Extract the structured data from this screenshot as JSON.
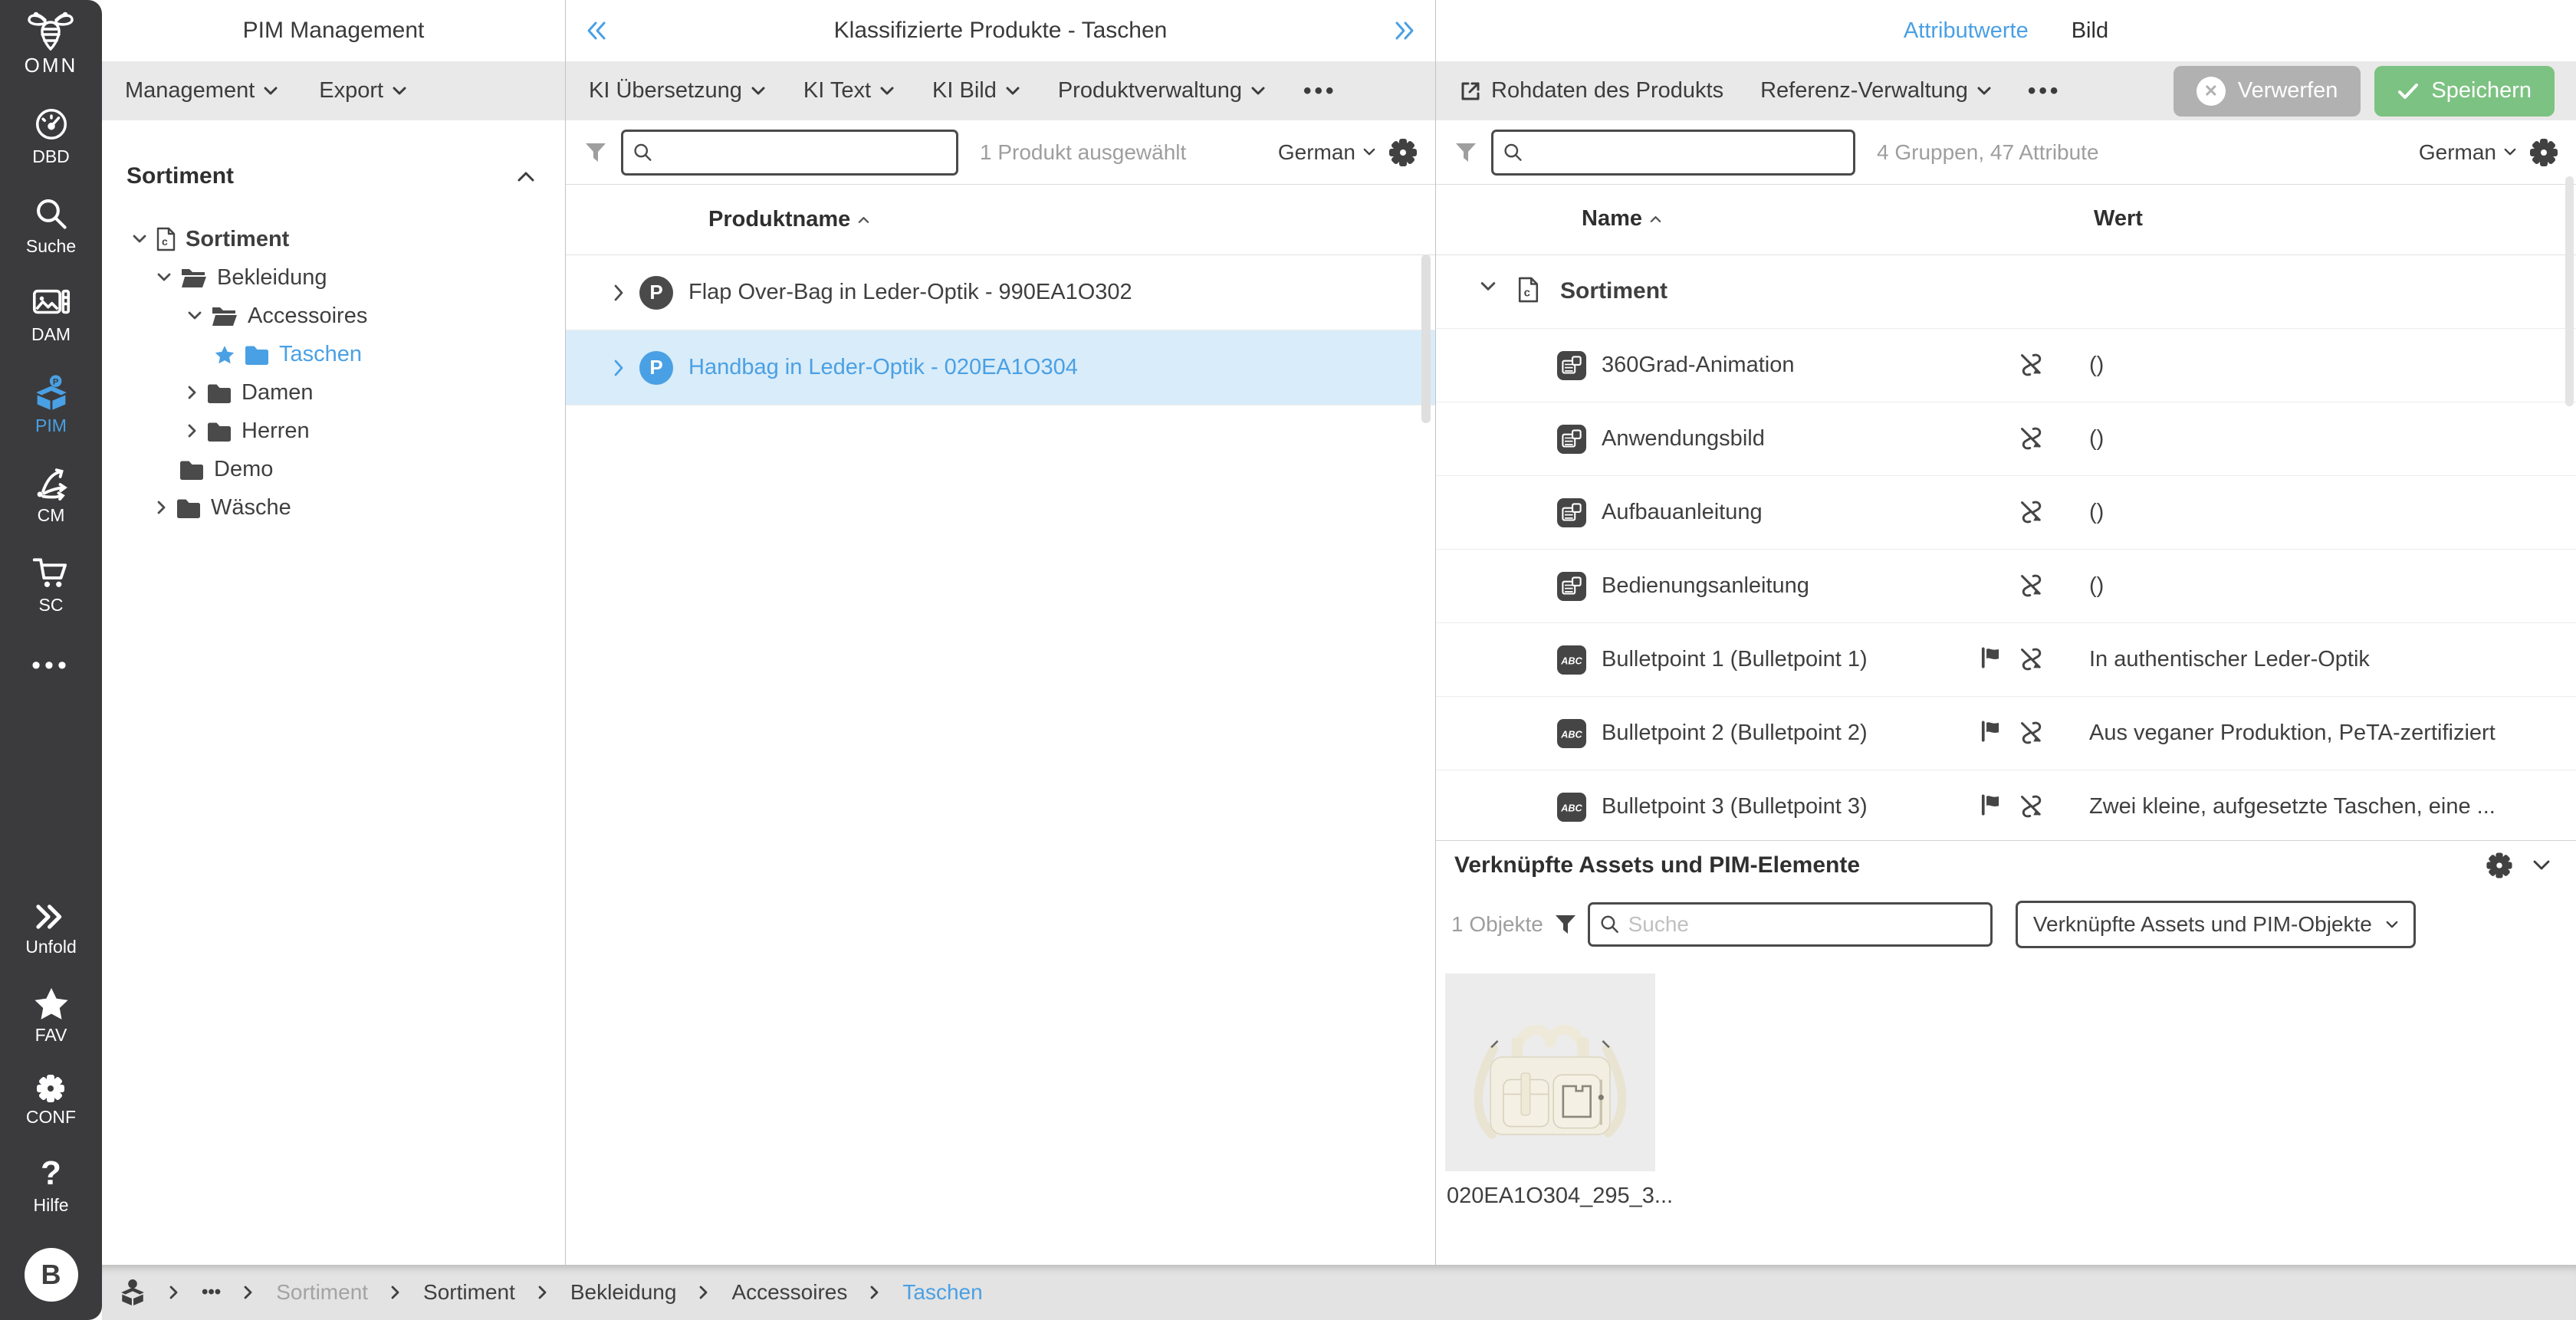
{
  "rail": {
    "logo_label": "OMN",
    "items": [
      {
        "label": "DBD"
      },
      {
        "label": "Suche"
      },
      {
        "label": "DAM"
      },
      {
        "label": "PIM"
      },
      {
        "label": "CM"
      },
      {
        "label": "SC"
      }
    ],
    "bottom_items": [
      {
        "label": "Unfold"
      },
      {
        "label": "FAV"
      },
      {
        "label": "CONF"
      },
      {
        "label": "Hilfe"
      }
    ],
    "avatar": "B"
  },
  "tree_panel": {
    "title": "PIM Management",
    "menus": [
      {
        "label": "Management"
      },
      {
        "label": "Export"
      }
    ],
    "section_title": "Sortiment",
    "nodes": [
      {
        "label": "Sortiment"
      },
      {
        "label": "Bekleidung"
      },
      {
        "label": "Accessoires"
      },
      {
        "label": "Taschen"
      },
      {
        "label": "Damen"
      },
      {
        "label": "Herren"
      },
      {
        "label": "Demo"
      },
      {
        "label": "Wäsche"
      }
    ]
  },
  "products_panel": {
    "title": "Klassifizierte Produkte - Taschen",
    "menus": [
      {
        "label": "KI Übersetzung"
      },
      {
        "label": "KI Text"
      },
      {
        "label": "KI Bild"
      },
      {
        "label": "Produktverwaltung"
      }
    ],
    "selection_status": "1 Produkt ausgewählt",
    "language": "German",
    "column_header": "Produktname",
    "rows": [
      {
        "name": "Flap Over-Bag in Leder-Optik - 990EA1O302",
        "badge": "P"
      },
      {
        "name": "Handbag in Leder-Optik - 020EA1O304",
        "badge": "P"
      }
    ]
  },
  "attributes_panel": {
    "tabs": [
      {
        "label": "Attributwerte"
      },
      {
        "label": "Bild"
      }
    ],
    "toolbar": {
      "raw_data": "Rohdaten des Produkts",
      "reference": "Referenz-Verwaltung"
    },
    "discard_label": "Verwerfen",
    "save_label": "Speichern",
    "summary": "4 Gruppen, 47 Attribute",
    "language": "German",
    "columns": {
      "name": "Name",
      "value": "Wert"
    },
    "group_label": "Sortiment",
    "rows": [
      {
        "name": "360Grad-Animation",
        "value": "()"
      },
      {
        "name": "Anwendungsbild",
        "value": "()"
      },
      {
        "name": "Aufbauanleitung",
        "value": "()"
      },
      {
        "name": "Bedienungsanleitung",
        "value": "()"
      },
      {
        "name": "Bulletpoint 1 (Bulletpoint 1)",
        "value": "In authentischer Leder-Optik"
      },
      {
        "name": "Bulletpoint 2 (Bulletpoint 2)",
        "value": "Aus veganer Produktion, PeTA-zertifiziert"
      },
      {
        "name": "Bulletpoint 3 (Bulletpoint 3)",
        "value": "Zwei kleine, aufgesetzte Taschen, eine ..."
      }
    ],
    "linked": {
      "title": "Verknüpfte Assets und PIM-Elemente",
      "count_label": "1 Objekte",
      "search_placeholder": "Suche",
      "filter_label": "Verknüpfte Assets und PIM-Objekte",
      "thumbnail_caption": "020EA1O304_295_3..."
    }
  },
  "breadcrumb": {
    "ellipsis": "•••",
    "items": [
      {
        "label": "Sortiment"
      },
      {
        "label": "Sortiment"
      },
      {
        "label": "Bekleidung"
      },
      {
        "label": "Accessoires"
      },
      {
        "label": "Taschen"
      }
    ]
  },
  "colors": {
    "accent_blue": "#4aa0e4",
    "save_green": "#7cc282",
    "discard_gray": "#b1b1b1",
    "rail_dark": "#3b3b3d",
    "selected_row": "#d9ecf9"
  }
}
